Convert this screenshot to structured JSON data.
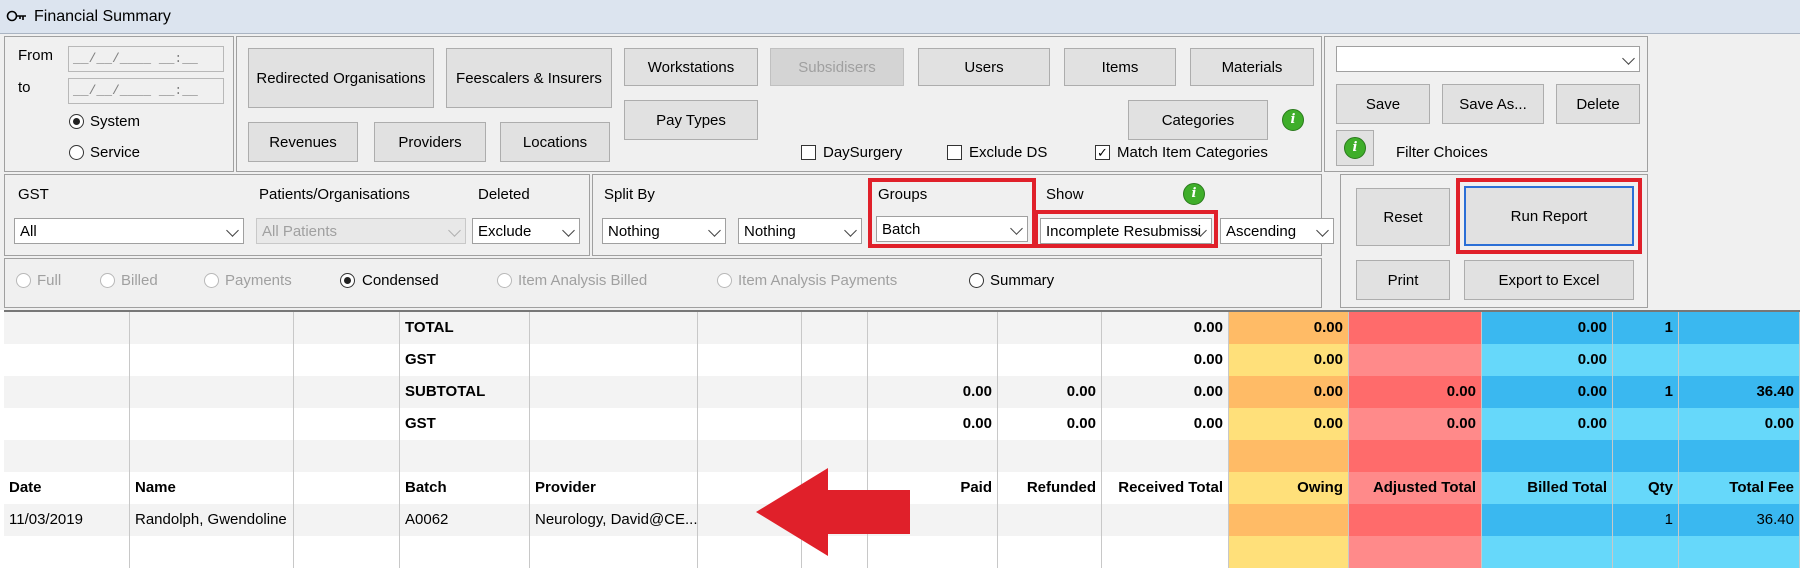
{
  "window": {
    "title": "Financial Summary"
  },
  "dates": {
    "from_label": "From",
    "to_label": "to",
    "from_value": "__/__/____ __:__",
    "to_value": "__/__/____ __:__",
    "system_label": "System",
    "service_label": "Service"
  },
  "filter_buttons": {
    "redirected_orgs": "Redirected Organisations",
    "feescalers": "Feescalers & Insurers",
    "workstations": "Workstations",
    "subsidisers": "Subsidisers",
    "users": "Users",
    "items": "Items",
    "materials": "Materials",
    "pay_types": "Pay Types",
    "revenues": "Revenues",
    "providers": "Providers",
    "locations": "Locations",
    "categories": "Categories"
  },
  "checkboxes": {
    "day_surgery": "DaySurgery",
    "exclude_ds": "Exclude DS",
    "match_item_categories": "Match Item Categories"
  },
  "saved_filters": {
    "selected": "",
    "save": "Save",
    "save_as": "Save As...",
    "delete": "Delete",
    "filter_choices": "Filter Choices"
  },
  "options": {
    "gst_label": "GST",
    "gst_value": "All",
    "patients_label": "Patients/Organisations",
    "patients_value": "All Patients",
    "deleted_label": "Deleted",
    "deleted_value": "Exclude",
    "split_by_label": "Split By",
    "split1_value": "Nothing",
    "split2_value": "Nothing",
    "groups_label": "Groups",
    "groups_value": "Batch",
    "show_label": "Show",
    "show_value": "Incomplete Resubmissi",
    "order_value": "Ascending"
  },
  "actions": {
    "reset": "Reset",
    "run_report": "Run Report",
    "print": "Print",
    "export": "Export to Excel"
  },
  "report_types": {
    "full": "Full",
    "billed": "Billed",
    "payments": "Payments",
    "condensed": "Condensed",
    "item_billed": "Item Analysis Billed",
    "item_payments": "Item Analysis Payments",
    "summary": "Summary"
  },
  "grid": {
    "totals": [
      {
        "label": "TOTAL",
        "paid": "",
        "refunded": "",
        "received": "0.00",
        "owing": "0.00",
        "adjusted": "",
        "billed": "0.00",
        "qty": "1",
        "fee": ""
      },
      {
        "label": "GST",
        "paid": "",
        "refunded": "",
        "received": "0.00",
        "owing": "0.00",
        "adjusted": "",
        "billed": "0.00",
        "qty": "",
        "fee": ""
      },
      {
        "label": "SUBTOTAL",
        "paid": "0.00",
        "refunded": "0.00",
        "received": "0.00",
        "owing": "0.00",
        "adjusted": "0.00",
        "billed": "0.00",
        "qty": "1",
        "fee": "36.40"
      },
      {
        "label": "GST",
        "paid": "0.00",
        "refunded": "0.00",
        "received": "0.00",
        "owing": "0.00",
        "adjusted": "0.00",
        "billed": "0.00",
        "qty": "",
        "fee": "0.00"
      }
    ],
    "headers": {
      "date": "Date",
      "name": "Name",
      "batch": "Batch",
      "provider": "Provider",
      "paid": "Paid",
      "refunded": "Refunded",
      "received": "Received Total",
      "owing": "Owing",
      "adjusted": "Adjusted Total",
      "billed": "Billed Total",
      "qty": "Qty",
      "fee": "Total Fee"
    },
    "rows": [
      {
        "date": "11/03/2019",
        "name": "Randolph, Gwendoline",
        "batch": "A0062",
        "provider": "Neurology, David@CE...",
        "qty": "1",
        "fee": "36.40"
      }
    ]
  },
  "colors": {
    "owing_dark": "#ffbb66",
    "owing_light": "#ffe07a",
    "adjusted_dark": "#ff6b6b",
    "adjusted_light": "#ff8a8a",
    "billed_dark": "#3ab8f0",
    "billed_light": "#66d8fa",
    "highlight": "#e0202a",
    "arrow": "#e0202a"
  }
}
